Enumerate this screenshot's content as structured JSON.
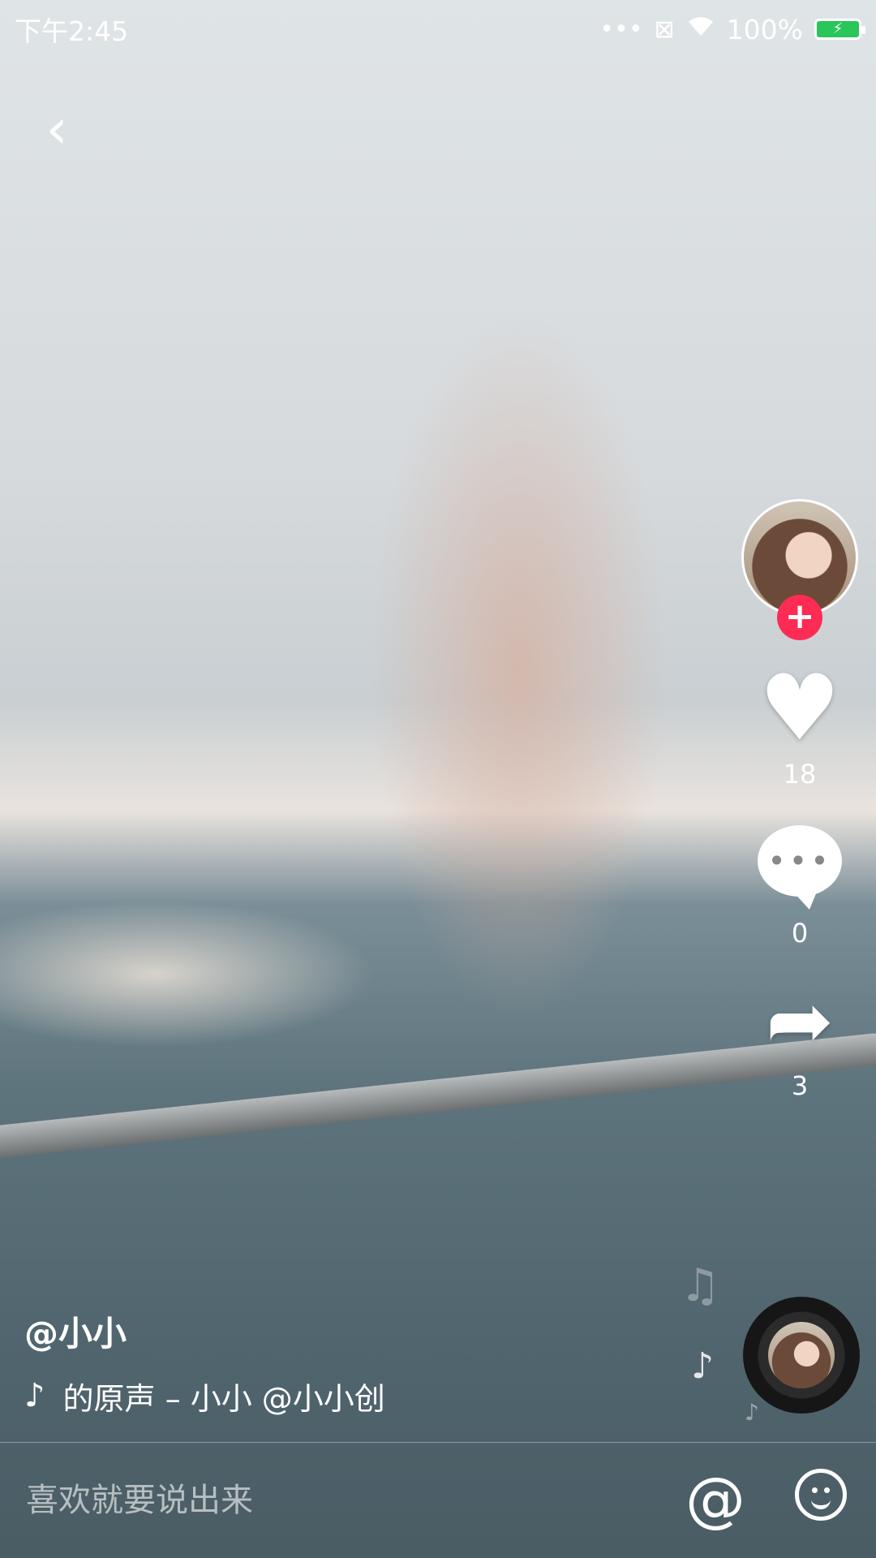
{
  "status_bar": {
    "time": "下午2:45",
    "dots": "•••",
    "sim_icon": "sim-card-disabled-icon",
    "wifi_icon": "wifi-icon",
    "battery_text": "100%",
    "battery_icon": "battery-charging-icon",
    "battery_color": "#29c65a"
  },
  "nav": {
    "back_glyph": "‹"
  },
  "actions": {
    "follow_glyph": "+",
    "follow_color": "#fe2c55",
    "like_glyph": "♥",
    "like_count": "18",
    "comment_glyph": "•••",
    "comment_count": "0",
    "share_glyph": "➦",
    "share_count": "3"
  },
  "video_info": {
    "username": "@小小",
    "music_icon": "♪",
    "music_text": "的原声 – 小小    @小小创"
  },
  "comment_bar": {
    "placeholder": "喜欢就要说出来",
    "mention_glyph": "@"
  }
}
